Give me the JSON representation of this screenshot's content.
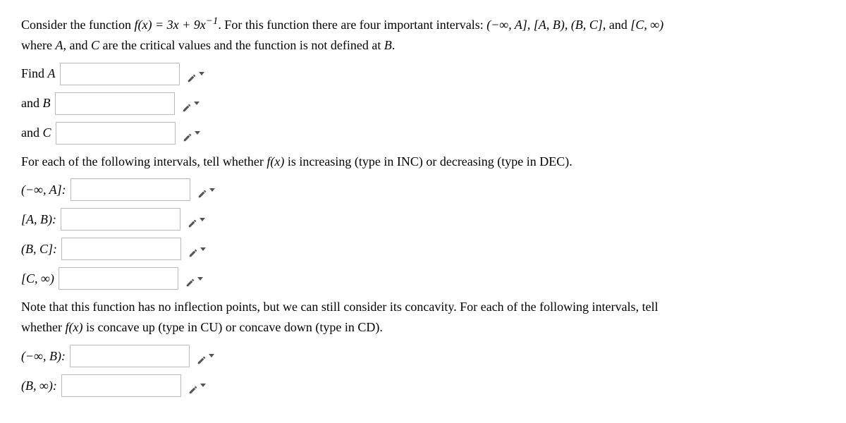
{
  "intro": {
    "pre": "Consider the function ",
    "func": "f(x) = 3x + 9x",
    "exp": "−1",
    "post1": ". For this function there are four important intervals: ",
    "intervals": "(−∞, A], [A, B), (B, C], ",
    "and_text": "and ",
    "last_interval": "[C, ∞)",
    "line2_pre": "where ",
    "line2_a": "A",
    "line2_mid": ", and ",
    "line2_c": "C",
    "line2_post": " are the critical values and the function is not defined at ",
    "line2_b": "B",
    "line2_end": "."
  },
  "findA": {
    "label": "Find ",
    "var": "A"
  },
  "findB": {
    "label": "and ",
    "var": "B"
  },
  "findC": {
    "label": "and ",
    "var": "C"
  },
  "incdec_prompt": {
    "pre": "For each of the following intervals, tell whether ",
    "fx": "f(x)",
    "post": " is increasing (type in INC) or decreasing (type in DEC)."
  },
  "int1": "(−∞, A]:",
  "int2": "[A, B):",
  "int3": "(B, C]:",
  "int4": "[C, ∞)",
  "concavity_prompt": {
    "line1": "Note that this function has no inflection points, but we can still consider its concavity. For each of the following intervals, tell",
    "line2_pre": "whether ",
    "line2_fx": "f(x)",
    "line2_post": " is concave up (type in CU) or concave down (type in CD)."
  },
  "conc1": "(−∞, B):",
  "conc2": "(B, ∞):"
}
